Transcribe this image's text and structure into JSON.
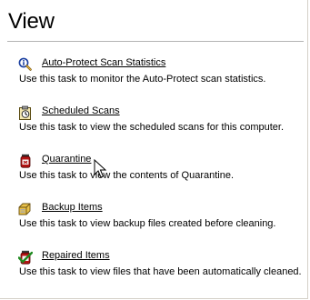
{
  "page": {
    "title": "View"
  },
  "tasks": [
    {
      "icon": "info-magnifier-icon",
      "link": "Auto-Protect Scan Statistics",
      "description": "Use this task to monitor the Auto-Protect scan statistics."
    },
    {
      "icon": "scheduled-clipboard-icon",
      "link": "Scheduled Scans",
      "description": "Use this task to view the scheduled scans for this computer."
    },
    {
      "icon": "quarantine-jar-icon",
      "link": "Quarantine",
      "description": "Use this task to view the contents of Quarantine."
    },
    {
      "icon": "backup-folder-icon",
      "link": "Backup Items",
      "description": "Use this task to view backup files created before cleaning."
    },
    {
      "icon": "repaired-checkmark-icon",
      "link": "Repaired Items",
      "description": "Use this task to view files that have been automatically cleaned."
    }
  ]
}
